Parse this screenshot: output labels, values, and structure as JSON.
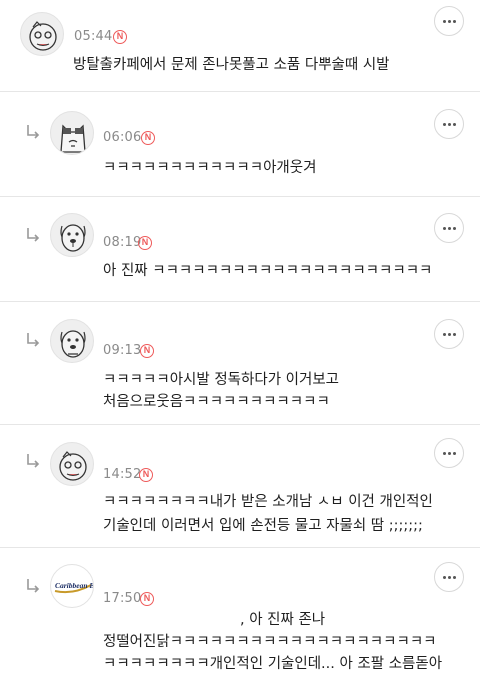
{
  "comments": [
    {
      "time": "05:44",
      "badge": "N",
      "text": "방탈출카페에서 문제 존나못풀고 소품 다뿌술때 시발",
      "avatar_icon": "cartoon-avatar-icon"
    },
    {
      "time": "06:06",
      "badge": "N",
      "text": "ㅋㅋㅋㅋㅋㅋㅋㅋㅋㅋㅋㅋ아개웃겨",
      "avatar_icon": "cat-avatar-icon"
    },
    {
      "time": "08:19",
      "badge": "N",
      "text": "아 진짜 ㅋㅋㅋㅋㅋㅋㅋㅋㅋㅋㅋㅋㅋㅋㅋㅋㅋㅋㅋㅋㅋ",
      "avatar_icon": "dog-avatar-icon"
    },
    {
      "time": "09:13",
      "badge": "N",
      "line1": "ㅋㅋㅋㅋㅋ아시발 정독하다가 이거보고",
      "line2": "처음으로웃음ㅋㅋㅋㅋㅋㅋㅋㅋㅋㅋㅋ",
      "avatar_icon": "dog-avatar-icon"
    },
    {
      "time": "14:52",
      "badge": "N",
      "line1": "ㅋㅋㅋㅋㅋㅋㅋㅋ내가 받은 소개남 ㅅㅂ 이건 개인적인",
      "line2": "기술인데 이러면서 입에 손전등 물고 자물쇠 땀 ;;;;;;;",
      "avatar_icon": "cartoon-avatar-icon"
    },
    {
      "time": "17:50",
      "badge": "N",
      "line0": ", 아 진짜 존나",
      "line1": "정떨어진닭ㅋㅋㅋㅋㅋㅋㅋㅋㅋㅋㅋㅋㅋㅋㅋㅋㅋㅋㅋㅋ",
      "line2": "ㅋㅋㅋㅋㅋㅋㅋㅋ개인적인 기술인데... 아 조팔 소름돋아",
      "avatar_icon": "logo-avatar-icon",
      "logo_text": "Caribbean Bay"
    }
  ],
  "colors": {
    "badge": "#ee5a5a",
    "time": "#8a8a8a",
    "divider": "#e6e6e6"
  }
}
